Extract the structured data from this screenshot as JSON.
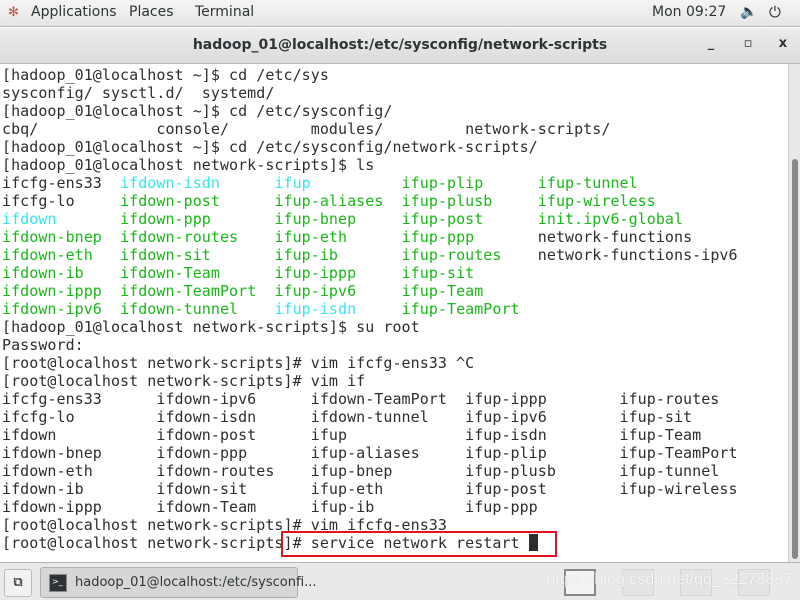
{
  "topbar": {
    "applications": "Applications",
    "places": "Places",
    "terminal": "Terminal",
    "clock": "Mon 09:27"
  },
  "window": {
    "title": "hadoop_01@localhost:/etc/sysconfig/network-scripts",
    "minimize": "_",
    "maximize": "▫",
    "close": "x"
  },
  "colors": {
    "k": "#2e2e2e",
    "g": "#18b818",
    "c": "#33e6f2",
    "highlight": "#e0141e"
  },
  "terminal": {
    "lines": [
      [
        [
          "[hadoop_01@localhost ~]$ cd /etc/sys",
          "k"
        ]
      ],
      [
        [
          "sysconfig/ sysctl.d/  systemd/",
          "k"
        ]
      ],
      [
        [
          "[hadoop_01@localhost ~]$ cd /etc/sysconfig/",
          "k"
        ]
      ],
      [
        [
          "cbq/             console/         modules/         network-scripts/",
          "k"
        ]
      ],
      [
        [
          "[hadoop_01@localhost ~]$ cd /etc/sysconfig/network-scripts/",
          "k"
        ]
      ],
      [
        [
          "[hadoop_01@localhost network-scripts]$ ls",
          "k"
        ]
      ],
      [
        [
          "ifcfg-ens33  ",
          "k"
        ],
        [
          "ifdown-isdn      ",
          "c"
        ],
        [
          "ifup          ",
          "c"
        ],
        [
          "ifup-plip      ",
          "g"
        ],
        [
          "ifup-tunnel",
          "g"
        ]
      ],
      [
        [
          "ifcfg-lo     ",
          "k"
        ],
        [
          "ifdown-post      ",
          "g"
        ],
        [
          "ifup-aliases  ",
          "g"
        ],
        [
          "ifup-plusb     ",
          "g"
        ],
        [
          "ifup-wireless",
          "g"
        ]
      ],
      [
        [
          "ifdown       ",
          "c"
        ],
        [
          "ifdown-ppp       ",
          "g"
        ],
        [
          "ifup-bnep     ",
          "g"
        ],
        [
          "ifup-post      ",
          "g"
        ],
        [
          "init.ipv6-global",
          "g"
        ]
      ],
      [
        [
          "ifdown-bnep  ",
          "g"
        ],
        [
          "ifdown-routes    ",
          "g"
        ],
        [
          "ifup-eth      ",
          "g"
        ],
        [
          "ifup-ppp       ",
          "g"
        ],
        [
          "network-functions",
          "k"
        ]
      ],
      [
        [
          "ifdown-eth   ",
          "g"
        ],
        [
          "ifdown-sit       ",
          "g"
        ],
        [
          "ifup-ib       ",
          "g"
        ],
        [
          "ifup-routes    ",
          "g"
        ],
        [
          "network-functions-ipv6",
          "k"
        ]
      ],
      [
        [
          "ifdown-ib    ",
          "g"
        ],
        [
          "ifdown-Team      ",
          "g"
        ],
        [
          "ifup-ippp     ",
          "g"
        ],
        [
          "ifup-sit",
          "g"
        ]
      ],
      [
        [
          "ifdown-ippp  ",
          "g"
        ],
        [
          "ifdown-TeamPort  ",
          "g"
        ],
        [
          "ifup-ipv6     ",
          "g"
        ],
        [
          "ifup-Team",
          "g"
        ]
      ],
      [
        [
          "ifdown-ipv6  ",
          "g"
        ],
        [
          "ifdown-tunnel    ",
          "g"
        ],
        [
          "ifup-isdn     ",
          "c"
        ],
        [
          "ifup-TeamPort",
          "g"
        ]
      ],
      [
        [
          "[hadoop_01@localhost network-scripts]$ su root",
          "k"
        ]
      ],
      [
        [
          "Password:",
          "k"
        ]
      ],
      [
        [
          "[root@localhost network-scripts]# vim ifcfg-ens33 ^C",
          "k"
        ]
      ],
      [
        [
          "[root@localhost network-scripts]# vim if",
          "k"
        ]
      ],
      [
        [
          "ifcfg-ens33      ifdown-ipv6      ifdown-TeamPort  ifup-ippp        ifup-routes",
          "k"
        ]
      ],
      [
        [
          "ifcfg-lo         ifdown-isdn      ifdown-tunnel    ifup-ipv6        ifup-sit",
          "k"
        ]
      ],
      [
        [
          "ifdown           ifdown-post      ifup             ifup-isdn        ifup-Team",
          "k"
        ]
      ],
      [
        [
          "ifdown-bnep      ifdown-ppp       ifup-aliases     ifup-plip        ifup-TeamPort",
          "k"
        ]
      ],
      [
        [
          "ifdown-eth       ifdown-routes    ifup-bnep        ifup-plusb       ifup-tunnel",
          "k"
        ]
      ],
      [
        [
          "ifdown-ib        ifdown-sit       ifup-eth         ifup-post        ifup-wireless",
          "k"
        ]
      ],
      [
        [
          "ifdown-ippp      ifdown-Team      ifup-ib          ifup-ppp",
          "k"
        ]
      ],
      [
        [
          "[root@localhost network-scripts]# vim ifcfg-ens33",
          "k"
        ]
      ],
      [
        [
          "[root@localhost network-scripts]# service network restart ",
          "k"
        ]
      ]
    ]
  },
  "taskbar": {
    "task_label": "hadoop_01@localhost:/etc/sysconfi...",
    "watermark": "https://blog.csdn.net/qq_32278887"
  }
}
